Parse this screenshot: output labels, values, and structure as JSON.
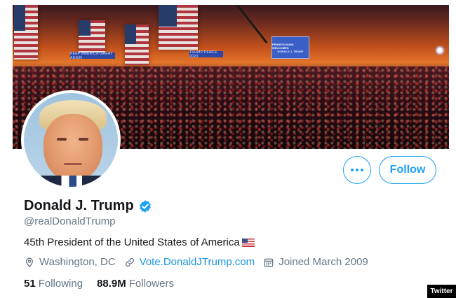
{
  "banner": {
    "signs": [
      "KEEP AMERICA GREAT AGAIN",
      "TRUMP PENCE 2020"
    ],
    "screen_line1": "PENNSYLVANIA WELCOMES",
    "screen_line2": "DONALD J. TRUMP"
  },
  "actions": {
    "more_icon": "more-dots-icon",
    "follow_label": "Follow"
  },
  "profile": {
    "display_name": "Donald J. Trump",
    "verified_icon": "verified-badge-icon",
    "handle": "@realDonaldTrump",
    "bio": "45th President of the United States of America",
    "bio_flag_icon": "us-flag-icon",
    "location": "Washington, DC",
    "website": "Vote.DonaldJTrump.com",
    "joined": "Joined March 2009"
  },
  "stats": {
    "following_count": "51",
    "following_label": "Following",
    "followers_count": "88.9M",
    "followers_label": "Followers"
  },
  "credit": "Twitter",
  "colors": {
    "accent": "#1da1f2",
    "link": "#1b95e0",
    "secondary_text": "#657786",
    "primary_text": "#14171a"
  }
}
